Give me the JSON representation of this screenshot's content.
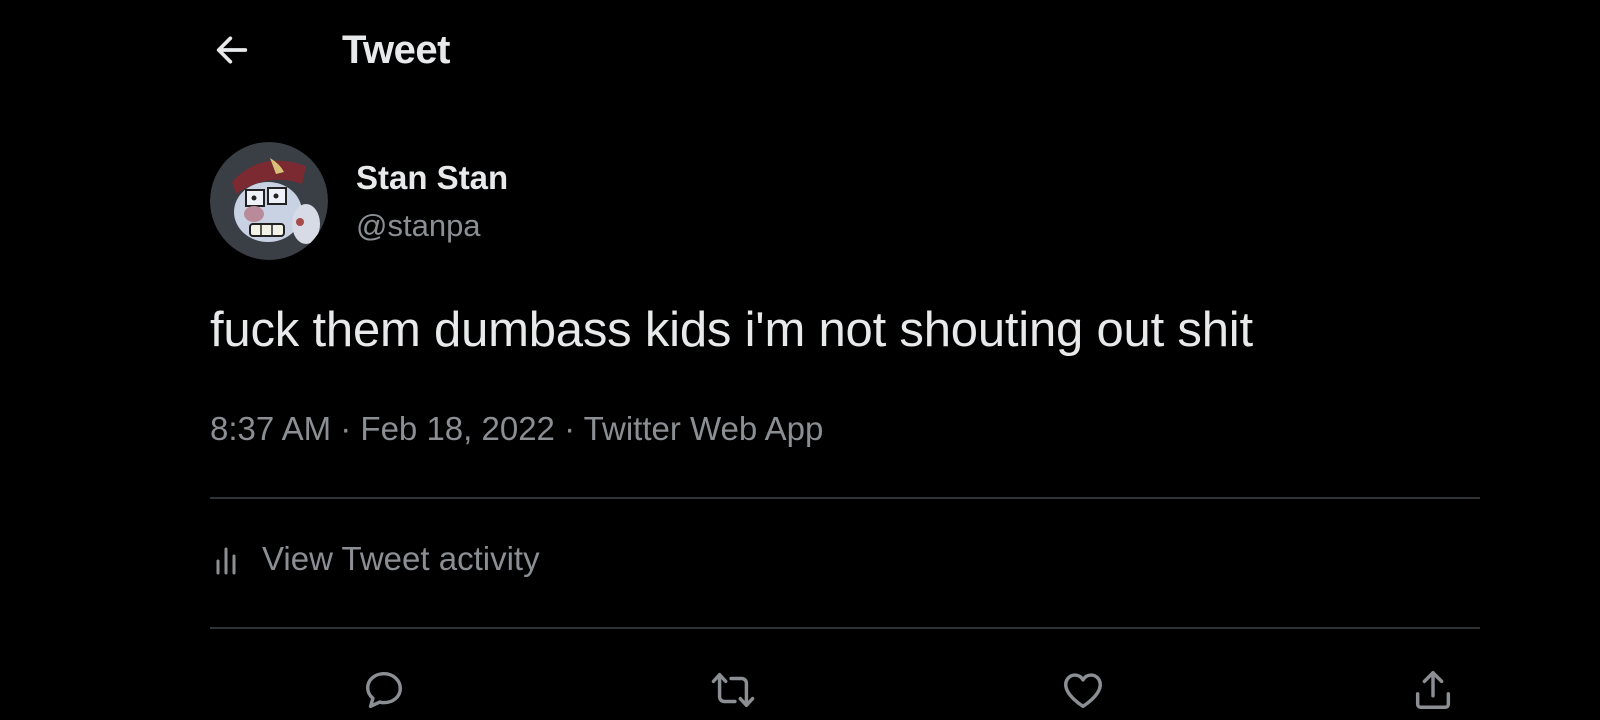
{
  "header": {
    "title": "Tweet",
    "back_icon": "arrow-left-icon"
  },
  "author": {
    "display_name": "Stan Stan",
    "handle": "@stanpa",
    "avatar": "cartoon-avatar"
  },
  "tweet": {
    "text": "fuck them dumbass kids i'm not shouting out shit",
    "time": "8:37 AM",
    "date": "Feb 18, 2022",
    "source": "Twitter Web App",
    "separator": "·"
  },
  "activity": {
    "label": "View Tweet activity",
    "icon": "bar-chart-icon"
  },
  "actions": [
    {
      "name": "reply",
      "icon": "comment-icon"
    },
    {
      "name": "retweet",
      "icon": "retweet-icon"
    },
    {
      "name": "like",
      "icon": "heart-icon"
    },
    {
      "name": "share",
      "icon": "share-icon"
    }
  ],
  "colors": {
    "background": "#000000",
    "primary_text": "#e7e9ea",
    "secondary_text": "#8b8f94",
    "divider": "#2f3336"
  }
}
